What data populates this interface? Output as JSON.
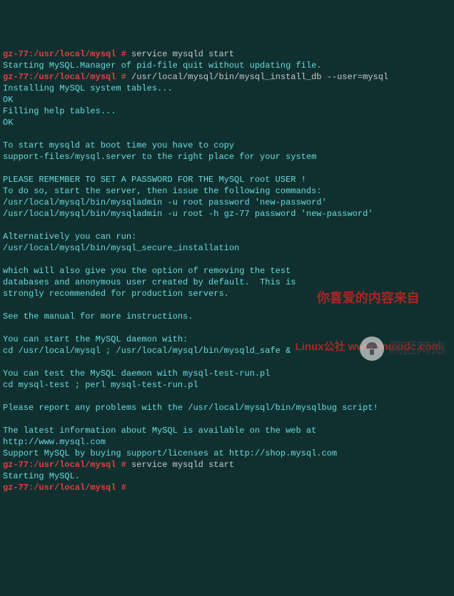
{
  "prompt": {
    "user_host": "gz-77:",
    "path": "/usr/local/mysql",
    "hash": " #"
  },
  "cmd1": "service mysqld start",
  "out1a": "Starting MySQL.Manager of pid-file quit without updating file.",
  "cmd2": "/usr/local/mysql/bin/mysql_install_db --user=mysql",
  "out2": {
    "l1": "Installing MySQL system tables...",
    "l2": "OK",
    "l3": "Filling help tables...",
    "l4": "OK",
    "l5": "To start mysqld at boot time you have to copy",
    "l6": "support-files/mysql.server to the right place for your system",
    "l7": "PLEASE REMEMBER TO SET A PASSWORD FOR THE MySQL root USER !",
    "l8": "To do so, start the server, then issue the following commands:",
    "l9": "/usr/local/mysql/bin/mysqladmin -u root password 'new-password'",
    "l10": "/usr/local/mysql/bin/mysqladmin -u root -h gz-77 password 'new-password'",
    "l11": "Alternatively you can run:",
    "l12": "/usr/local/mysql/bin/mysql_secure_installation",
    "l13": "which will also give you the option of removing the test",
    "l14": "databases and anonymous user created by default.  This is",
    "l15": "strongly recommended for production servers.",
    "l16": "See the manual for more instructions.",
    "l17": "You can start the MySQL daemon with:",
    "l18": "cd /usr/local/mysql ; /usr/local/mysql/bin/mysqld_safe &",
    "l19": "You can test the MySQL daemon with mysql-test-run.pl",
    "l20": "cd mysql-test ; perl mysql-test-run.pl",
    "l21": "Please report any problems with the /usr/local/mysql/bin/mysqlbug script!",
    "l22": "The latest information about MySQL is available on the web at",
    "l23": "http://www.mysql.com",
    "l24": "Support MySQL by buying support/licenses at http://shop.mysql.com"
  },
  "cmd3": "service mysqld start",
  "out3": "Starting MySQL.",
  "watermark1": {
    "line1": "你喜爱的内容来自",
    "line2": "Linux公社 www.linuxidc.com"
  },
  "watermark2": "黑区网络"
}
